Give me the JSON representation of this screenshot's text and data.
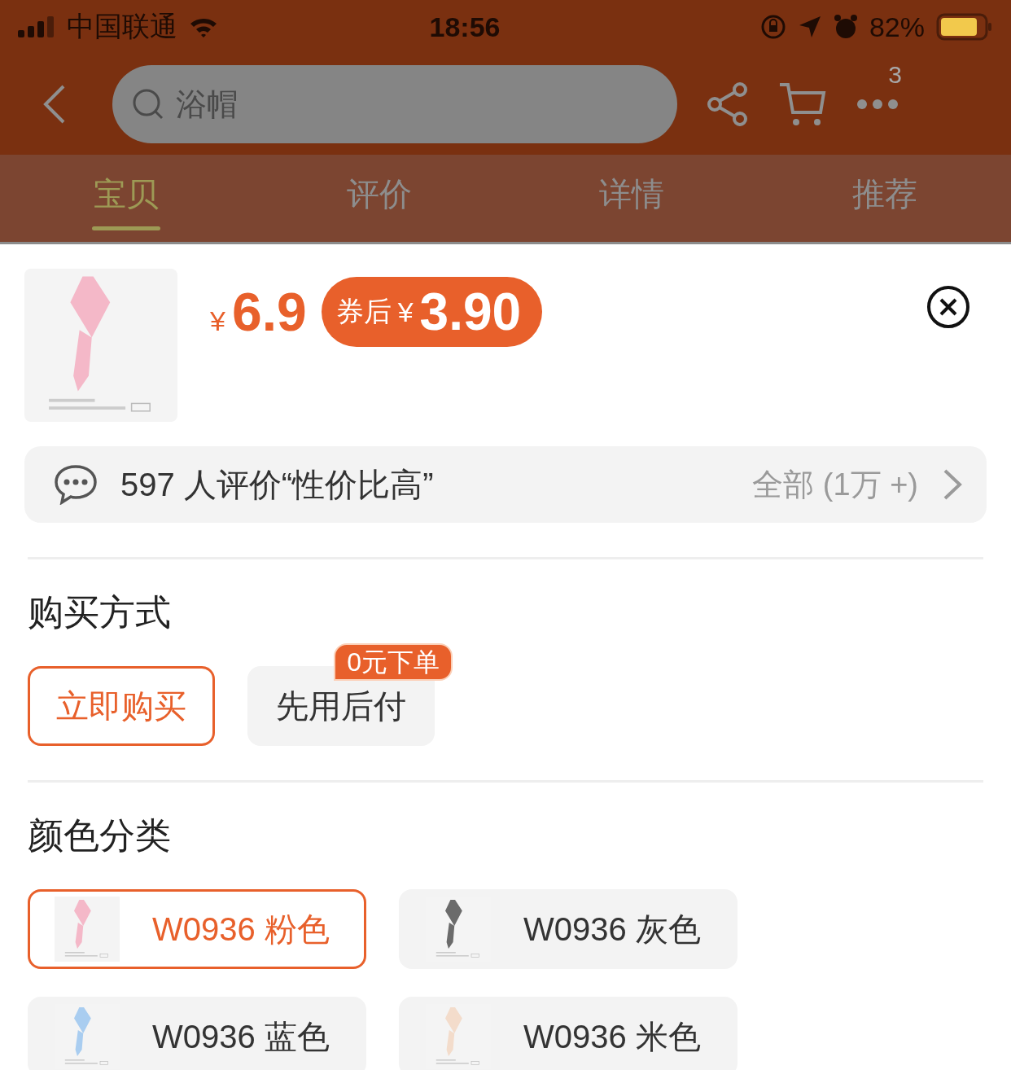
{
  "status_bar": {
    "carrier": "中国联通",
    "time": "18:56",
    "battery": "82%"
  },
  "header": {
    "search": {
      "placeholder": "浴帽"
    },
    "more_badge": "3"
  },
  "tabs": [
    {
      "label": "宝贝",
      "selected": true
    },
    {
      "label": "评价",
      "selected": false
    },
    {
      "label": "详情",
      "selected": false
    },
    {
      "label": "推荐",
      "selected": false
    }
  ],
  "product": {
    "currency": "¥",
    "price": "6.9",
    "coupon": {
      "label": "券后",
      "currency": "¥",
      "price": "3.90"
    }
  },
  "review_bar": {
    "text": "597 人评价“性价比高”",
    "link": "全部 (1万 +)"
  },
  "purchase": {
    "title": "购买方式",
    "options": [
      {
        "label": "立即购买",
        "selected": true
      },
      {
        "label": "先用后付",
        "selected": false,
        "badge": "0元下单"
      }
    ]
  },
  "colors": {
    "title": "颜色分类",
    "options": [
      {
        "label": "W0936 粉色",
        "selected": true,
        "color": "#f4b8c8"
      },
      {
        "label": "W0936 灰色",
        "selected": false,
        "color": "#6b6b6b"
      },
      {
        "label": "W0936 蓝色",
        "selected": false,
        "color": "#a9cdf0"
      },
      {
        "label": "W0936 米色",
        "selected": false,
        "color": "#f3dccb"
      }
    ]
  }
}
